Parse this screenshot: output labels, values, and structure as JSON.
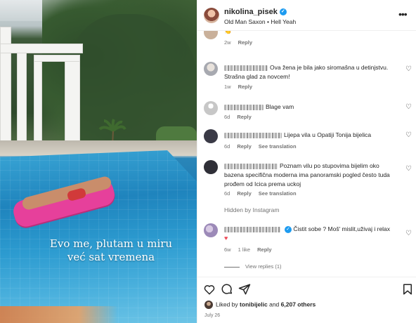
{
  "post": {
    "caption_lines": [
      "Evo me, plutam u miru",
      "već sat vremena"
    ]
  },
  "header": {
    "username": "nikolina_pisek",
    "music": "Old Man Saxon • Hell Yeah",
    "more_icon": "more-horizontal-icon"
  },
  "comments": [
    {
      "text": "",
      "emoji": "👏",
      "time": "2w",
      "reply_label": "Reply"
    },
    {
      "text": "Ova žena je bila jako siromašna u detinjstvu. Strašna glad za novcem!",
      "time": "1w",
      "reply_label": "Reply"
    },
    {
      "text": "Blage vam",
      "time": "6d",
      "reply_label": "Reply"
    },
    {
      "text": "Lijepa vila u Opatiji Tonija bijelica",
      "time": "6d",
      "reply_label": "Reply",
      "translation_label": "See translation"
    },
    {
      "text": "Poznam vilu po stupovima bijelim oko bazena specifična moderna ima panoramski pogled često tuda prođem od Icica prema uckoj",
      "time": "6d",
      "reply_label": "Reply",
      "translation_label": "See translation"
    },
    {
      "text": "Čistit sobe ? Moš' mislit,uživaj i relax",
      "emoji": "♥",
      "time": "6w",
      "likes": "1 like",
      "reply_label": "Reply",
      "view_replies": "View replies (1)"
    }
  ],
  "hidden_by": "Hidden by Instagram",
  "footer": {
    "liked_by_prefix": "Liked by",
    "liked_by_user": "tonibijelic",
    "and_label": "and",
    "others": "6,207 others",
    "date": "July 26"
  },
  "colors": {
    "verified": "#1d9bf0",
    "secondary_text": "#737373",
    "heart_red": "#ed4956"
  }
}
